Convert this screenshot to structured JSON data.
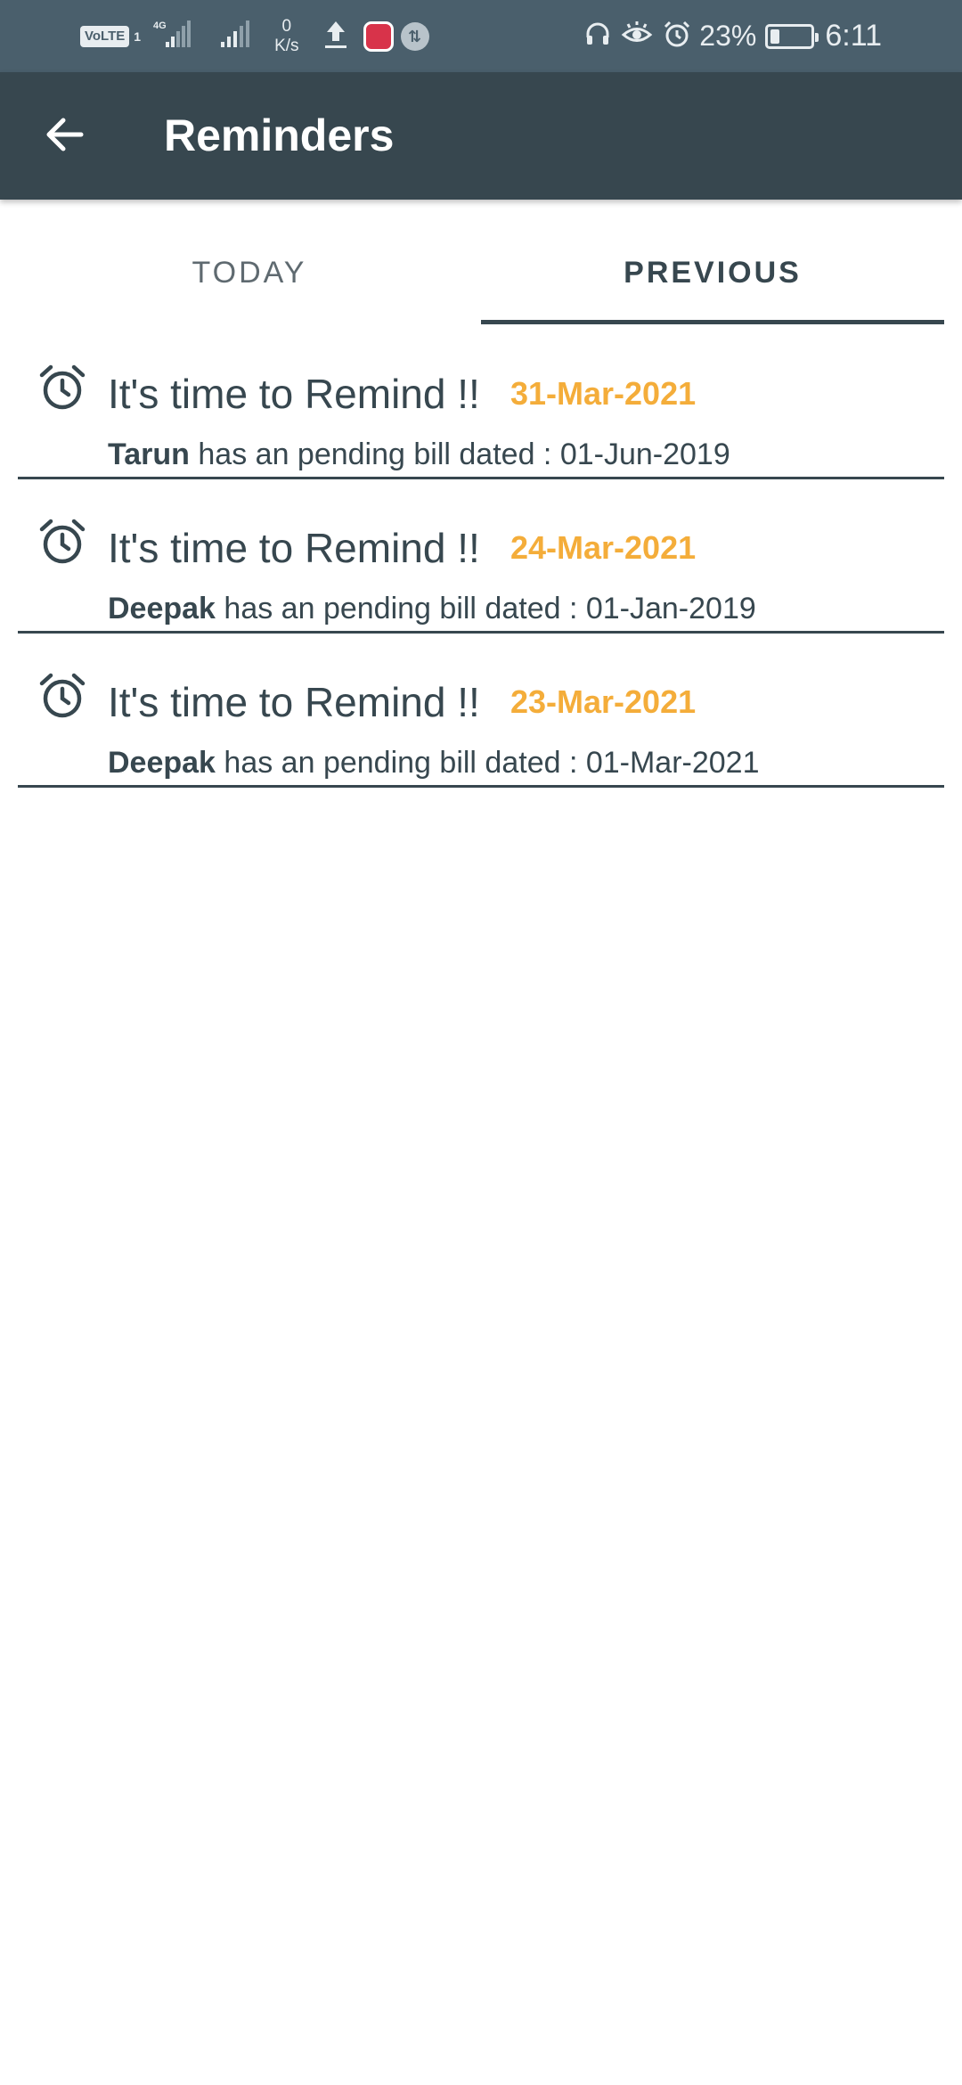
{
  "status_bar": {
    "network_tag": "VoLTE",
    "sim": "1",
    "net_type": "4G",
    "speed_value": "0",
    "speed_unit": "K/s",
    "battery_percent": "23%",
    "battery_level": 0.23,
    "time": "6:11"
  },
  "app_bar": {
    "title": "Reminders"
  },
  "tabs": [
    {
      "label": "TODAY",
      "selected": false
    },
    {
      "label": "PREVIOUS",
      "selected": true
    }
  ],
  "reminders": [
    {
      "title": "It's time to Remind !!",
      "date": "31-Mar-2021",
      "name": "Tarun",
      "text": "has an pending bill dated : 01-Jun-2019"
    },
    {
      "title": "It's time to Remind !!",
      "date": "24-Mar-2021",
      "name": "Deepak",
      "text": "has an pending bill dated : 01-Jan-2019"
    },
    {
      "title": "It's time to Remind !!",
      "date": "23-Mar-2021",
      "name": "Deepak",
      "text": "has an pending bill dated : 01-Mar-2021"
    }
  ],
  "colors": {
    "primary": "#37474f",
    "status_bar": "#4a5f6c",
    "date_accent": "#f4ad3a"
  },
  "icons": {
    "back": "arrow-left-icon",
    "reminder": "alarm-clock-icon"
  }
}
